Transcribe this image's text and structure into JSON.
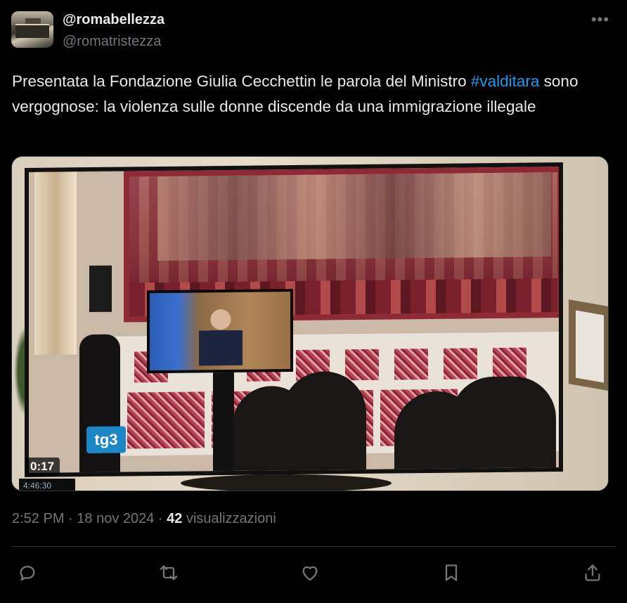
{
  "author": {
    "display_name": "@romabellezza",
    "handle": "@romatristezza"
  },
  "tweet": {
    "text_before": "Presentata la Fondazione Giulia Cecchettin le parola del Ministro ",
    "hashtag": "#valditara",
    "text_after": " sono vergognose: la violenza sulle donne discende da una immigrazione illegale"
  },
  "media": {
    "duration": "0:17",
    "tv_logo": "tg3",
    "clock_overlay": "4:46:30"
  },
  "meta": {
    "time": "2:52 PM",
    "separator": " · ",
    "date": "18 nov 2024",
    "separator2": " · ",
    "views_count": "42",
    "views_label": " visualizzazioni"
  },
  "actions": {
    "icons": [
      "reply-icon",
      "retweet-icon",
      "like-icon",
      "bookmark-icon",
      "share-icon"
    ]
  },
  "colors": {
    "background": "#000000",
    "text": "#e7e9ea",
    "secondary": "#71767b",
    "link": "#1d9bf0",
    "border": "#2f3336"
  }
}
